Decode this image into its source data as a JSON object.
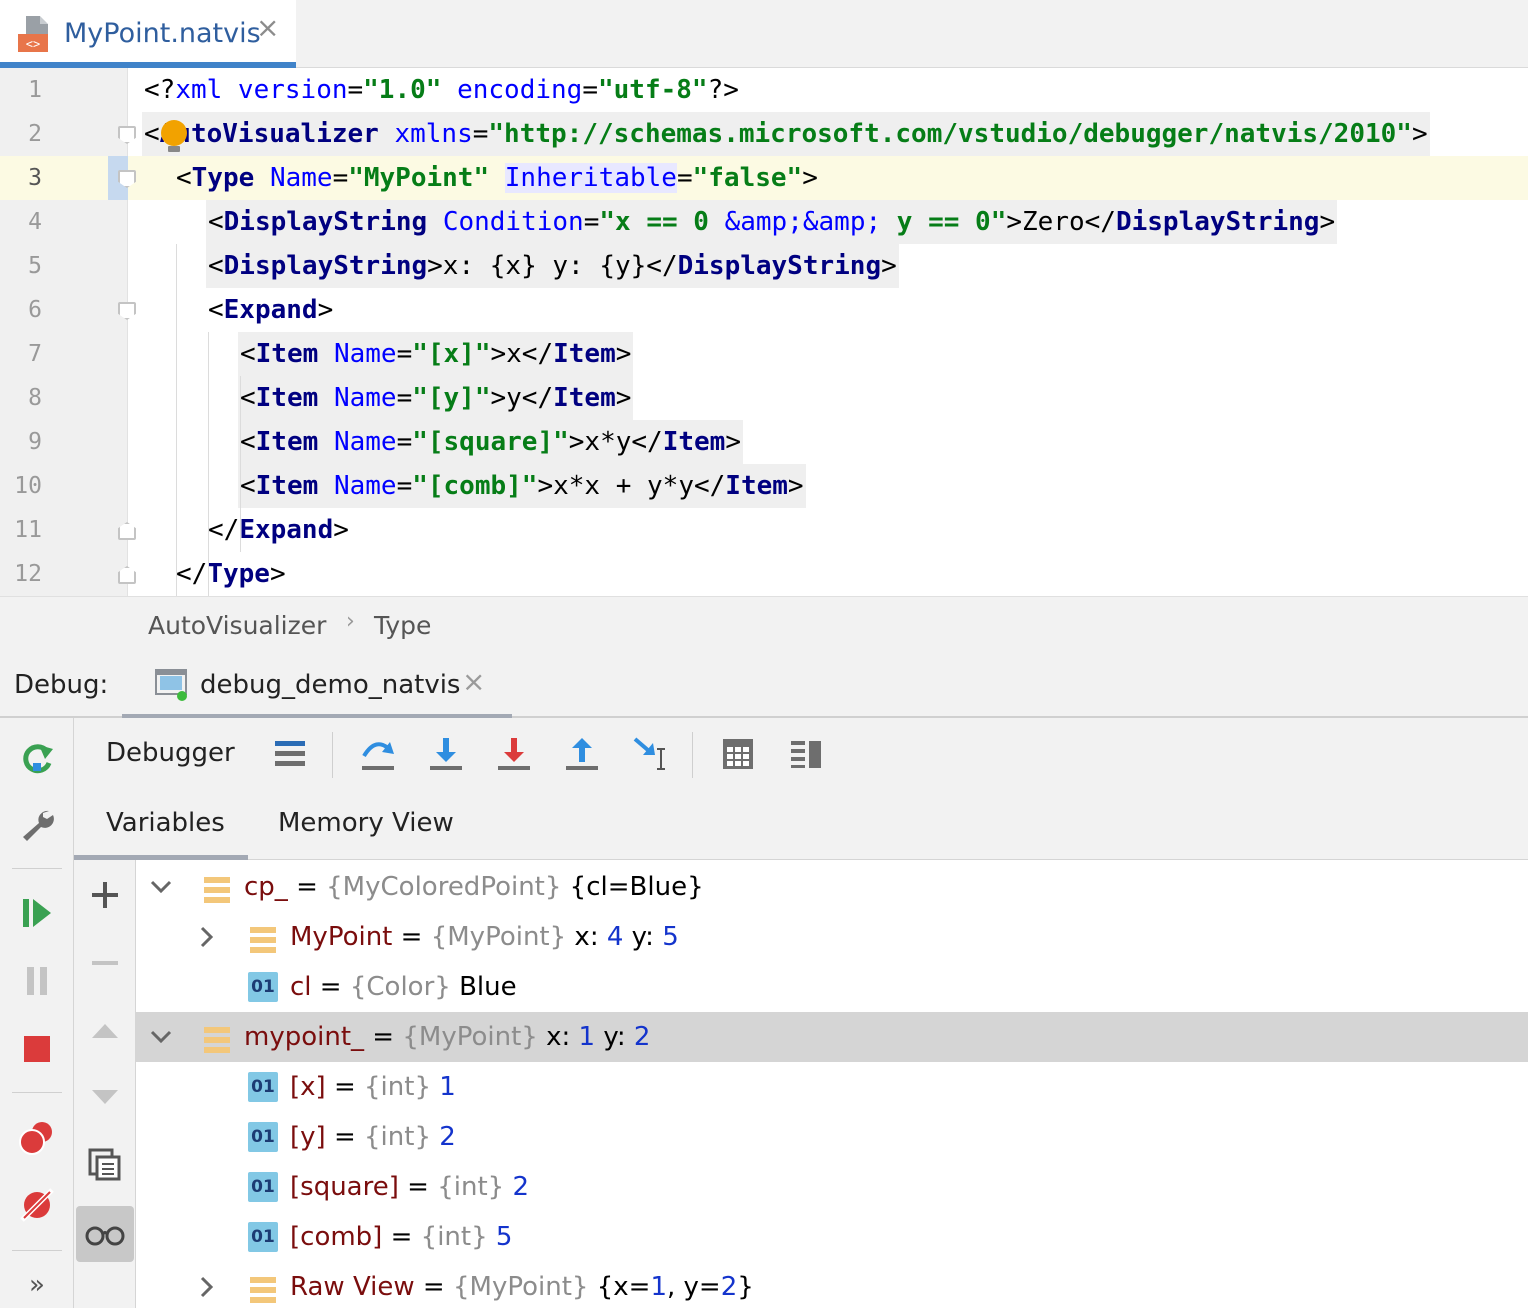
{
  "tab": {
    "filename": "MyPoint.natvis",
    "close_glyph": "×",
    "icon": "xml-file-icon"
  },
  "editor": {
    "lines": [
      {
        "n": "1",
        "segments": [
          {
            "c": "t-pi",
            "t": "<?"
          },
          {
            "c": "t-attr",
            "t": "xml version"
          },
          {
            "c": "t-pi",
            "t": "="
          },
          {
            "c": "t-val",
            "t": "\"1.0\""
          },
          {
            "c": "t-pi",
            "t": " "
          },
          {
            "c": "t-attr",
            "t": "encoding"
          },
          {
            "c": "t-pi",
            "t": "="
          },
          {
            "c": "t-val",
            "t": "\"utf-8\""
          },
          {
            "c": "t-pi",
            "t": "?>"
          }
        ]
      },
      {
        "n": "2",
        "segments": [
          {
            "c": "t-txt",
            "t": "<"
          },
          {
            "c": "t-tag",
            "t": "AutoVisualizer"
          },
          {
            "c": "t-txt",
            "t": " "
          },
          {
            "c": "t-attr",
            "t": "xmlns"
          },
          {
            "c": "t-txt",
            "t": "="
          },
          {
            "c": "t-val",
            "t": "\"http://schemas.microsoft.com/vstudio/debugger/natvis/2010\""
          },
          {
            "c": "t-txt",
            "t": ">"
          }
        ]
      },
      {
        "n": "3",
        "segments": [
          {
            "c": "t-txt",
            "t": "<"
          },
          {
            "c": "t-tag",
            "t": "Type"
          },
          {
            "c": "t-txt",
            "t": " "
          },
          {
            "c": "t-attr",
            "t": "Name"
          },
          {
            "c": "t-txt",
            "t": "="
          },
          {
            "c": "t-val",
            "t": "\"MyPoint\""
          },
          {
            "c": "t-txt",
            "t": " "
          },
          {
            "c": "t-attr t-inh",
            "t": "Inheritable"
          },
          {
            "c": "t-txt",
            "t": "="
          },
          {
            "c": "t-val",
            "t": "\"false\""
          },
          {
            "c": "t-txt",
            "t": ">"
          }
        ]
      },
      {
        "n": "4",
        "segments": [
          {
            "c": "t-txt",
            "t": "<"
          },
          {
            "c": "t-tag",
            "t": "DisplayString"
          },
          {
            "c": "t-txt",
            "t": " "
          },
          {
            "c": "t-attr",
            "t": "Condition"
          },
          {
            "c": "t-txt",
            "t": "="
          },
          {
            "c": "t-val",
            "t": "\"x == 0 "
          },
          {
            "c": "t-attr",
            "t": "&amp;&amp;"
          },
          {
            "c": "t-val",
            "t": " y == 0\""
          },
          {
            "c": "t-txt",
            "t": ">Zero</"
          },
          {
            "c": "t-tag",
            "t": "DisplayString"
          },
          {
            "c": "t-txt",
            "t": ">"
          }
        ]
      },
      {
        "n": "5",
        "segments": [
          {
            "c": "t-txt",
            "t": "<"
          },
          {
            "c": "t-tag",
            "t": "DisplayString"
          },
          {
            "c": "t-txt",
            "t": ">x: {x} y: {y}</"
          },
          {
            "c": "t-tag",
            "t": "DisplayString"
          },
          {
            "c": "t-txt",
            "t": ">"
          }
        ]
      },
      {
        "n": "6",
        "segments": [
          {
            "c": "t-txt",
            "t": "<"
          },
          {
            "c": "t-tag",
            "t": "Expand"
          },
          {
            "c": "t-txt",
            "t": ">"
          }
        ]
      },
      {
        "n": "7",
        "segments": [
          {
            "c": "t-txt",
            "t": "<"
          },
          {
            "c": "t-tag",
            "t": "Item"
          },
          {
            "c": "t-txt",
            "t": " "
          },
          {
            "c": "t-attr",
            "t": "Name"
          },
          {
            "c": "t-txt",
            "t": "="
          },
          {
            "c": "t-val",
            "t": "\"[x]\""
          },
          {
            "c": "t-txt",
            "t": ">x</"
          },
          {
            "c": "t-tag",
            "t": "Item"
          },
          {
            "c": "t-txt",
            "t": ">"
          }
        ]
      },
      {
        "n": "8",
        "segments": [
          {
            "c": "t-txt",
            "t": "<"
          },
          {
            "c": "t-tag",
            "t": "Item"
          },
          {
            "c": "t-txt",
            "t": " "
          },
          {
            "c": "t-attr",
            "t": "Name"
          },
          {
            "c": "t-txt",
            "t": "="
          },
          {
            "c": "t-val",
            "t": "\"[y]\""
          },
          {
            "c": "t-txt",
            "t": ">y</"
          },
          {
            "c": "t-tag",
            "t": "Item"
          },
          {
            "c": "t-txt",
            "t": ">"
          }
        ]
      },
      {
        "n": "9",
        "segments": [
          {
            "c": "t-txt",
            "t": "<"
          },
          {
            "c": "t-tag",
            "t": "Item"
          },
          {
            "c": "t-txt",
            "t": " "
          },
          {
            "c": "t-attr",
            "t": "Name"
          },
          {
            "c": "t-txt",
            "t": "="
          },
          {
            "c": "t-val",
            "t": "\"[square]\""
          },
          {
            "c": "t-txt",
            "t": ">x*y</"
          },
          {
            "c": "t-tag",
            "t": "Item"
          },
          {
            "c": "t-txt",
            "t": ">"
          }
        ]
      },
      {
        "n": "10",
        "segments": [
          {
            "c": "t-txt",
            "t": "<"
          },
          {
            "c": "t-tag",
            "t": "Item"
          },
          {
            "c": "t-txt",
            "t": " "
          },
          {
            "c": "t-attr",
            "t": "Name"
          },
          {
            "c": "t-txt",
            "t": "="
          },
          {
            "c": "t-val",
            "t": "\"[comb]\""
          },
          {
            "c": "t-txt",
            "t": ">x*x + y*y</"
          },
          {
            "c": "t-tag",
            "t": "Item"
          },
          {
            "c": "t-txt",
            "t": ">"
          }
        ]
      },
      {
        "n": "11",
        "segments": [
          {
            "c": "t-txt",
            "t": "</"
          },
          {
            "c": "t-tag",
            "t": "Expand"
          },
          {
            "c": "t-txt",
            "t": ">"
          }
        ]
      },
      {
        "n": "12",
        "segments": [
          {
            "c": "t-txt",
            "t": "</"
          },
          {
            "c": "t-tag",
            "t": "Type"
          },
          {
            "c": "t-txt",
            "t": ">"
          }
        ]
      }
    ]
  },
  "breadcrumb": {
    "items": [
      "AutoVisualizer",
      "Type"
    ],
    "separator": "›"
  },
  "debug": {
    "label": "Debug:",
    "session_name": "debug_demo_natvis",
    "close_glyph": "×",
    "toolbar_title": "Debugger",
    "tabs": [
      "Variables",
      "Memory View"
    ],
    "sidebar_icons": [
      "rerun-icon",
      "settings-wrench-icon",
      "resume-icon",
      "pause-icon",
      "stop-icon",
      "view-breakpoints-icon",
      "mute-breakpoints-icon",
      "more-icon"
    ],
    "toolbar_icons": [
      "frames-menu-icon",
      "step-over-icon",
      "step-into-icon",
      "force-step-into-icon",
      "step-out-icon",
      "run-to-cursor-icon",
      "evaluate-expression-icon",
      "layout-icon"
    ],
    "variable_actions": [
      "add-watch-icon",
      "remove-watch-icon",
      "move-up-icon",
      "move-down-icon",
      "duplicate-watch-icon",
      "show-watches-icon"
    ],
    "more_glyph": "»"
  },
  "variables": [
    {
      "name": "cp_",
      "type": "{MyColoredPoint}",
      "value_parts": [
        {
          "c": "v-plain",
          "t": " {cl=Blue}"
        }
      ],
      "expanded": "open",
      "icon": "struct",
      "level": 0
    },
    {
      "name": "MyPoint",
      "type": "{MyPoint}",
      "value_parts": [
        {
          "c": "v-plain",
          "t": " x: "
        },
        {
          "c": "v-num",
          "t": "4"
        },
        {
          "c": "v-plain",
          "t": " y: "
        },
        {
          "c": "v-num",
          "t": "5"
        }
      ],
      "expanded": "closed",
      "icon": "struct",
      "level": 1
    },
    {
      "name": "cl",
      "type": "{Color}",
      "value_parts": [
        {
          "c": "v-plain",
          "t": " Blue"
        }
      ],
      "expanded": "none",
      "icon": "field",
      "level": 1
    },
    {
      "name": "mypoint_",
      "type": "{MyPoint}",
      "value_parts": [
        {
          "c": "v-plain",
          "t": " x: "
        },
        {
          "c": "v-num",
          "t": "1"
        },
        {
          "c": "v-plain",
          "t": " y: "
        },
        {
          "c": "v-num",
          "t": "2"
        }
      ],
      "expanded": "open",
      "icon": "struct",
      "level": 0,
      "selected": true
    },
    {
      "name": "[x]",
      "type": "{int}",
      "value_parts": [
        {
          "c": "v-num",
          "t": " 1"
        }
      ],
      "expanded": "none",
      "icon": "field",
      "level": 1
    },
    {
      "name": "[y]",
      "type": "{int}",
      "value_parts": [
        {
          "c": "v-num",
          "t": " 2"
        }
      ],
      "expanded": "none",
      "icon": "field",
      "level": 1
    },
    {
      "name": "[square]",
      "type": "{int}",
      "value_parts": [
        {
          "c": "v-num",
          "t": " 2"
        }
      ],
      "expanded": "none",
      "icon": "field",
      "level": 1
    },
    {
      "name": "[comb]",
      "type": "{int}",
      "value_parts": [
        {
          "c": "v-num",
          "t": " 5"
        }
      ],
      "expanded": "none",
      "icon": "field",
      "level": 1
    },
    {
      "name": "Raw View",
      "type": "{MyPoint}",
      "value_parts": [
        {
          "c": "v-plain",
          "t": " {x="
        },
        {
          "c": "v-num",
          "t": "1"
        },
        {
          "c": "v-plain",
          "t": ", y="
        },
        {
          "c": "v-num",
          "t": "2"
        },
        {
          "c": "v-plain",
          "t": "}"
        }
      ],
      "expanded": "closed",
      "icon": "struct",
      "level": 1
    }
  ],
  "field_icon_text": "01",
  "equals": " = ",
  "colors": {
    "tag": "#000080",
    "attribute": "#0000ff",
    "string": "#067d17",
    "var_name": "#7a0d0d",
    "number": "#1434cc",
    "accent_tab": "#4083c9",
    "stop_red": "#db3b3b",
    "resume_green": "#3aa152",
    "step_blue": "#2f8ee0"
  }
}
